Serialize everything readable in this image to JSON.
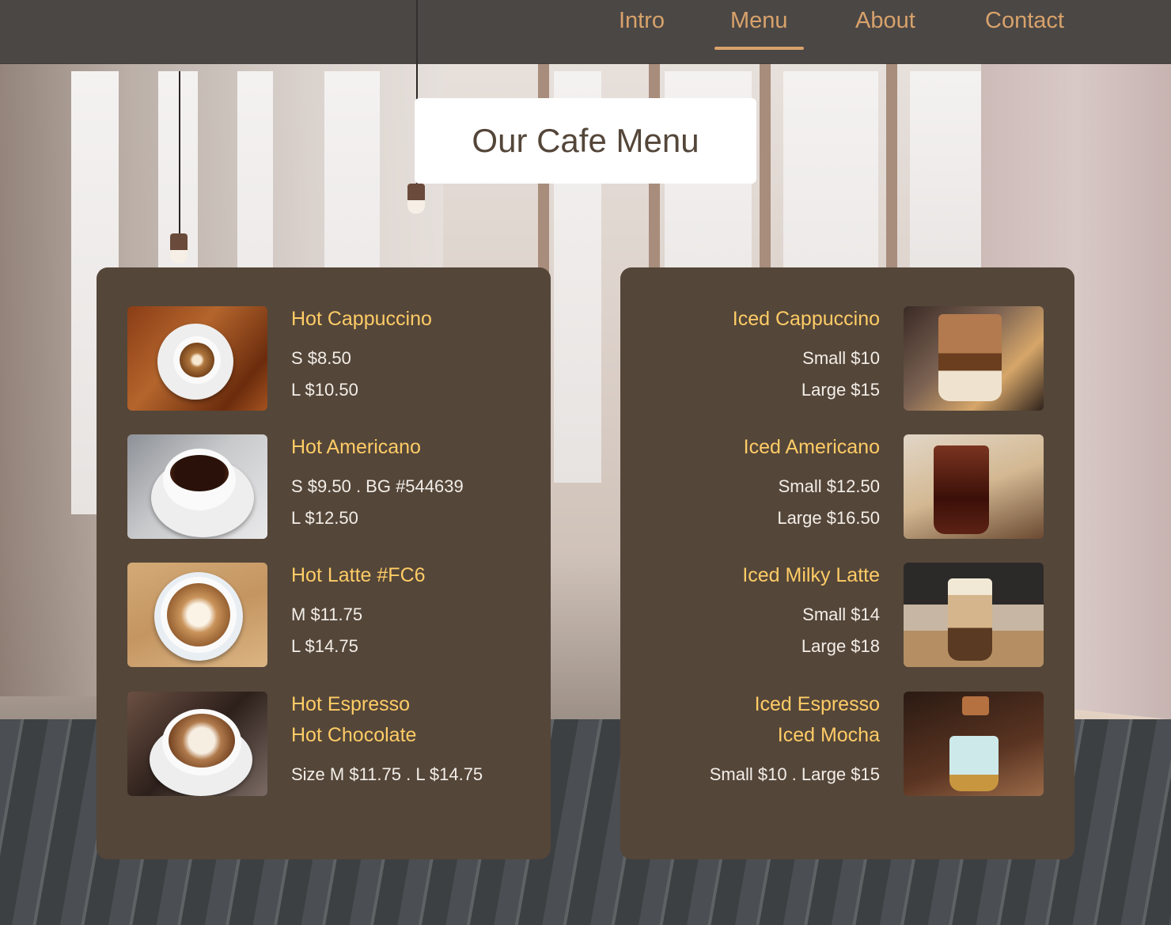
{
  "nav": {
    "items": [
      {
        "label": "Intro"
      },
      {
        "label": "Menu"
      },
      {
        "label": "About"
      },
      {
        "label": "Contact"
      }
    ]
  },
  "page_title": "Our Cafe Menu",
  "hot_menu": [
    {
      "name": "Hot Cappuccino",
      "prices": [
        "S $8.50",
        "L $10.50"
      ],
      "image": "cappuccino-cup-on-wood-icon"
    },
    {
      "name": "Hot Americano",
      "prices": [
        "S $9.50 . BG #544639",
        "L $12.50"
      ],
      "image": "black-coffee-cup-icon"
    },
    {
      "name": "Hot Latte #FC6",
      "prices": [
        "M $11.75",
        "L $14.75"
      ],
      "image": "latte-art-cup-icon"
    },
    {
      "names": [
        "Hot Espresso",
        "Hot Chocolate"
      ],
      "price": "Size M $11.75 . L $14.75",
      "image": "latte-art-saucer-icon"
    }
  ],
  "iced_menu": [
    {
      "name": "Iced Cappuccino",
      "prices": [
        "Small $10",
        "Large $15"
      ],
      "image": "iced-cappuccino-glass-icon"
    },
    {
      "name": "Iced Americano",
      "prices": [
        "Small $12.50",
        "Large $16.50"
      ],
      "image": "iced-americano-glass-icon"
    },
    {
      "name": "Iced Milky Latte",
      "prices": [
        "Small $14",
        "Large $18"
      ],
      "image": "iced-latte-caramel-glass-icon"
    },
    {
      "names": [
        "Iced Espresso",
        "Iced Mocha"
      ],
      "price": "Small $10 . Large $15",
      "image": "pouring-espresso-glass-icon"
    }
  ],
  "colors": {
    "nav_bg": "#343130",
    "nav_text": "#d8a26b",
    "panel_bg": "#544639",
    "item_name": "#ffcc66",
    "item_price": "#f3eee8",
    "title_text": "#544639"
  }
}
